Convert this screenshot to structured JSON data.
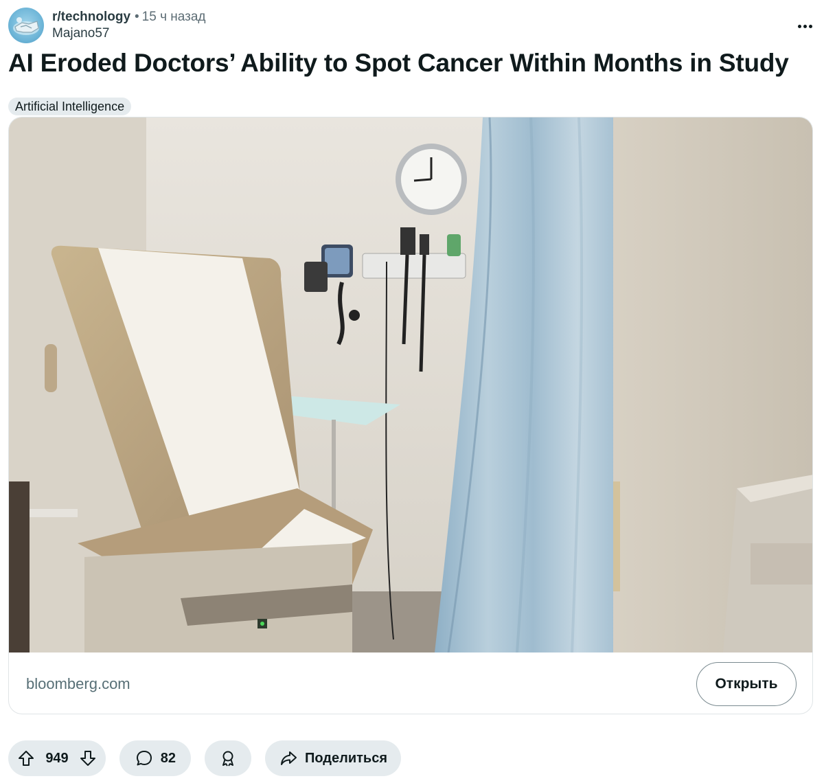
{
  "post": {
    "subreddit": "r/technology",
    "separator": "•",
    "time": "15 ч назад",
    "author": "Majano57",
    "title": "AI Eroded Doctors’ Ability to Spot Cancer Within Months in Study",
    "flair": "Artificial Intelligence"
  },
  "link_card": {
    "domain": "bloomberg.com",
    "open_label": "Открыть"
  },
  "actions": {
    "score": "949",
    "comments": "82",
    "share_label": "Поделиться"
  },
  "icons": {
    "more": "more-options-icon",
    "upvote": "upvote-arrow-icon",
    "downvote": "downvote-arrow-icon",
    "comment": "comment-bubble-icon",
    "award": "award-ribbon-icon",
    "share": "share-arrow-icon"
  }
}
